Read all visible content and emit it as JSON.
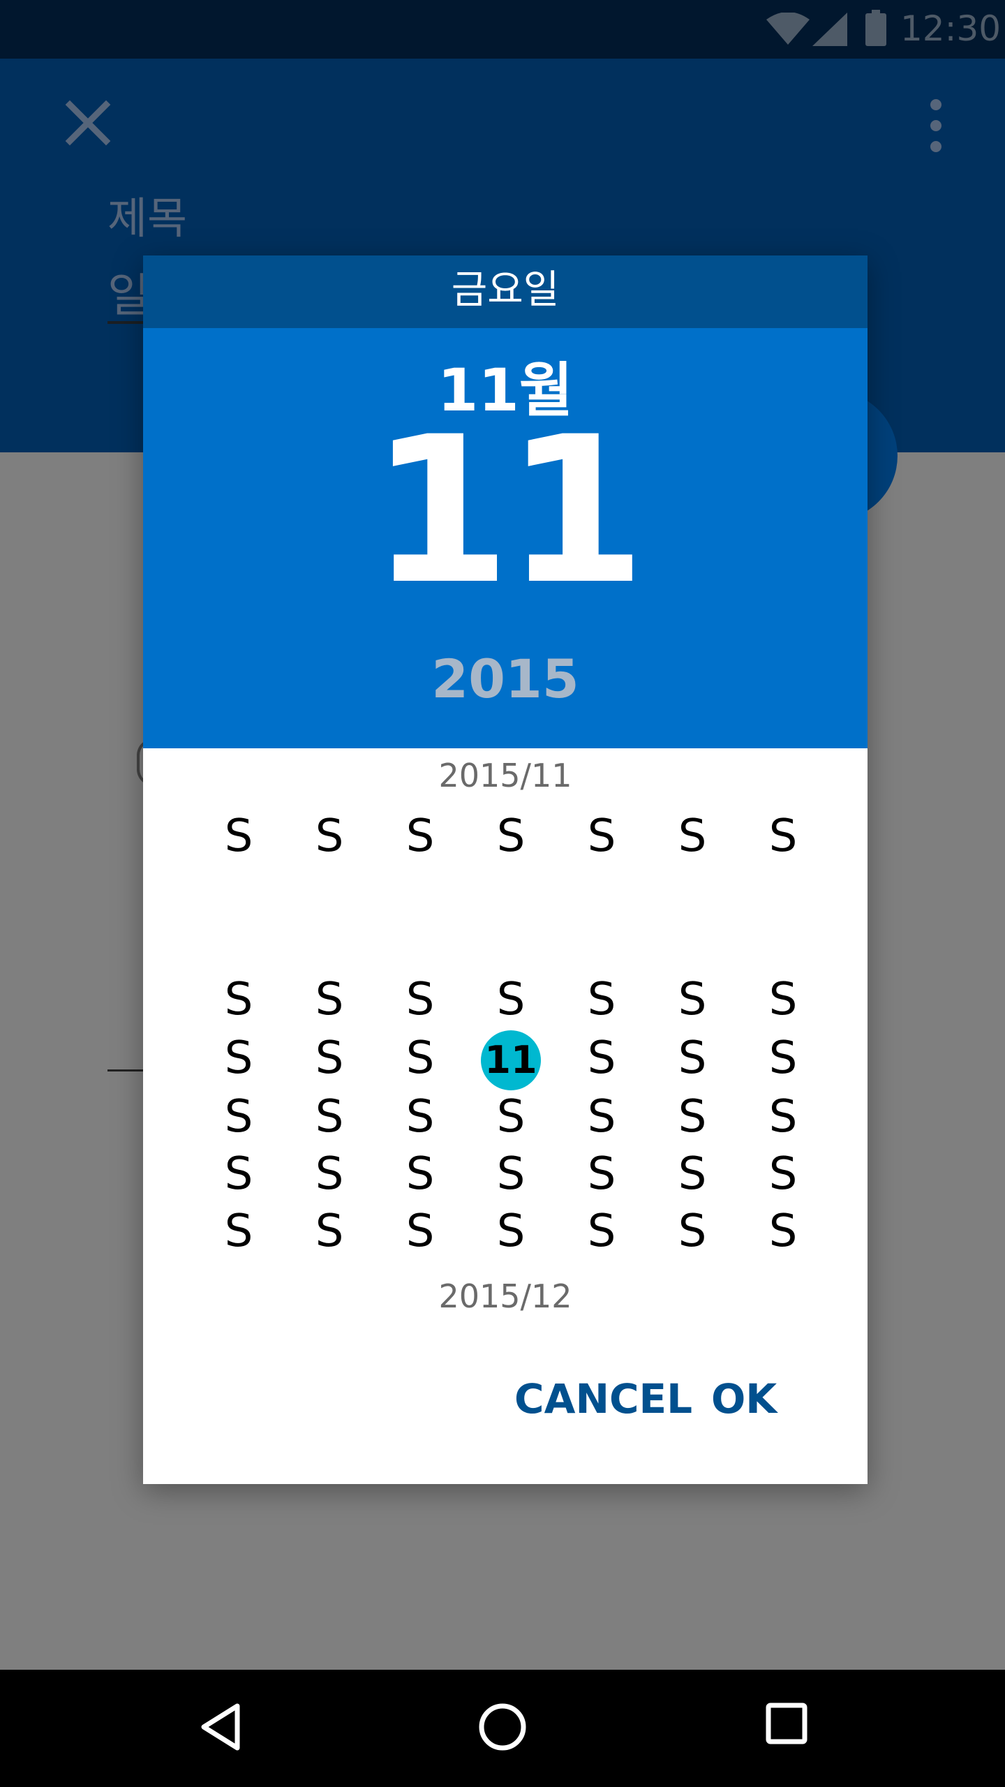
{
  "status_bar": {
    "time": "12:30",
    "icons": [
      "wifi-icon",
      "signal-icon",
      "battery-icon"
    ]
  },
  "app_bar": {
    "close_icon": "close-icon",
    "more_icon": "more-vert-icon",
    "title_label": "제목",
    "title_value": "일"
  },
  "date_picker": {
    "weekday": "금요일",
    "month": "11월",
    "day": "11",
    "year": "2015",
    "current_month_label": "2015/11",
    "next_month_label": "2015/12",
    "header_row": [
      "S",
      "S",
      "S",
      "S",
      "S",
      "S",
      "S"
    ],
    "weeks": [
      [
        "S",
        "S",
        "S",
        "S",
        "S",
        "S",
        "S"
      ],
      [
        "S",
        "S",
        "S",
        "11",
        "S",
        "S",
        "S"
      ],
      [
        "S",
        "S",
        "S",
        "S",
        "S",
        "S",
        "S"
      ],
      [
        "S",
        "S",
        "S",
        "S",
        "S",
        "S",
        "S"
      ],
      [
        "S",
        "S",
        "S",
        "S",
        "S",
        "S",
        "S"
      ]
    ],
    "selected_day": "11",
    "cancel_label": "CANCEL",
    "ok_label": "OK"
  },
  "nav_bar": {
    "icons": [
      "back-icon",
      "home-icon",
      "recents-icon"
    ]
  },
  "colors": {
    "status_bar": "#01172e",
    "app_bar": "#01305d",
    "dialog_header": "#0070c9",
    "weekday_band": "#01508e",
    "selected_day": "#00b8d0",
    "button_text": "#01508e"
  }
}
